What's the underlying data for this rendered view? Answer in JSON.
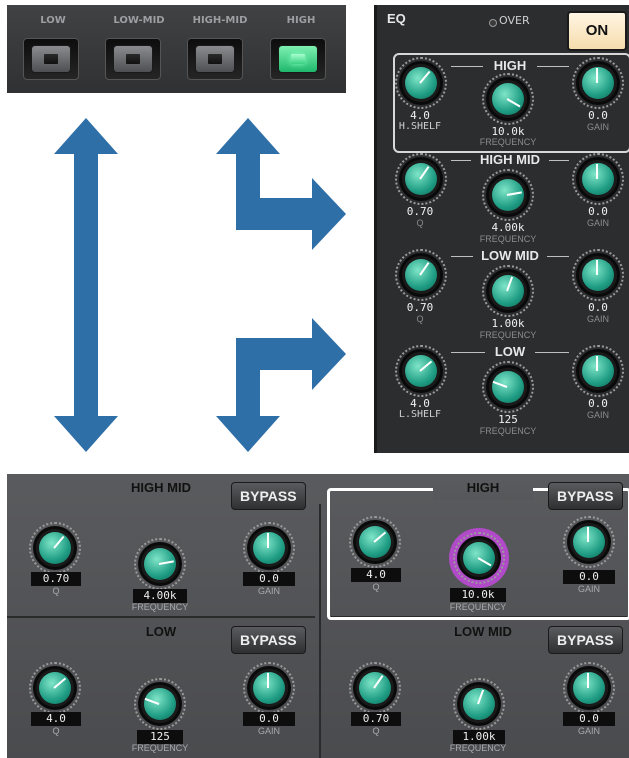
{
  "band_selector": {
    "labels": [
      "LOW",
      "LOW-MID",
      "HIGH-MID",
      "HIGH"
    ],
    "active": "HIGH"
  },
  "eq_panel": {
    "title": "EQ",
    "over_label": "OVER",
    "on_label": "ON",
    "bands": [
      {
        "title": "HIGH",
        "q_value": "4.0",
        "q_label": "H.SHELF",
        "freq_value": "10.0k",
        "freq_label": "FREQUENCY",
        "gain_value": "0.0",
        "gain_label": "GAIN"
      },
      {
        "title": "HIGH MID",
        "q_value": "0.70",
        "q_label": "Q",
        "freq_value": "4.00k",
        "freq_label": "FREQUENCY",
        "gain_value": "0.0",
        "gain_label": "GAIN"
      },
      {
        "title": "LOW MID",
        "q_value": "0.70",
        "q_label": "Q",
        "freq_value": "1.00k",
        "freq_label": "FREQUENCY",
        "gain_value": "0.0",
        "gain_label": "GAIN"
      },
      {
        "title": "LOW",
        "q_value": "4.0",
        "q_label": "L.SHELF",
        "freq_value": "125",
        "freq_label": "FREQUENCY",
        "gain_value": "0.0",
        "gain_label": "GAIN"
      }
    ]
  },
  "bottom_panels": {
    "bypass_label": "BYPASS",
    "panels": [
      {
        "title": "HIGH MID",
        "q_value": "0.70",
        "q_label": "Q",
        "freq_value": "4.00k",
        "freq_label": "FREQUENCY",
        "gain_value": "0.0",
        "gain_label": "GAIN"
      },
      {
        "title": "HIGH",
        "q_value": "4.0",
        "q_label": "Q",
        "freq_value": "10.0k",
        "freq_label": "FREQUENCY",
        "gain_value": "0.0",
        "gain_label": "GAIN"
      },
      {
        "title": "LOW",
        "q_value": "4.0",
        "q_label": "Q",
        "freq_value": "125",
        "freq_label": "FREQUENCY",
        "gain_value": "0.0",
        "gain_label": "GAIN"
      },
      {
        "title": "LOW MID",
        "q_value": "0.70",
        "q_label": "Q",
        "freq_value": "1.00k",
        "freq_label": "FREQUENCY",
        "gain_value": "0.0",
        "gain_label": "GAIN"
      }
    ]
  },
  "colors": {
    "arrow": "#2f6fa7",
    "knob_cap": "#2fb394",
    "active_ring": "#b04ac8"
  }
}
